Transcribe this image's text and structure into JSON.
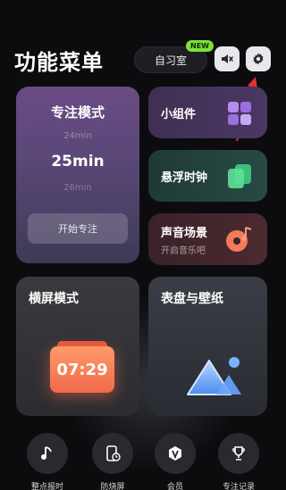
{
  "header": {
    "title": "功能菜单",
    "study_room_label": "自习室",
    "study_room_badge": "NEW"
  },
  "focus_mode": {
    "title": "专注模式",
    "time_prev": "24min",
    "time_current": "25min",
    "time_next": "26min",
    "start_label": "开始专注"
  },
  "widgets_card": {
    "title": "小组件"
  },
  "float_clock_card": {
    "title": "悬浮时钟"
  },
  "sound_card": {
    "title": "声音场景",
    "subtitle": "开启音乐吧"
  },
  "landscape_card": {
    "title": "横屏模式",
    "clock_time": "07:29"
  },
  "wallpaper_card": {
    "title": "表盘与壁纸"
  },
  "bottom_nav": [
    {
      "label": "整点报时",
      "icon": "music-note-icon"
    },
    {
      "label": "防烧屏",
      "icon": "phone-clock-icon"
    },
    {
      "label": "会员",
      "icon": "vip-badge-icon"
    },
    {
      "label": "专注记录",
      "icon": "trophy-icon"
    }
  ],
  "colors": {
    "background": "#0c0c0f",
    "accent_green": "#7ee03a",
    "annotation_red": "#e03030"
  }
}
